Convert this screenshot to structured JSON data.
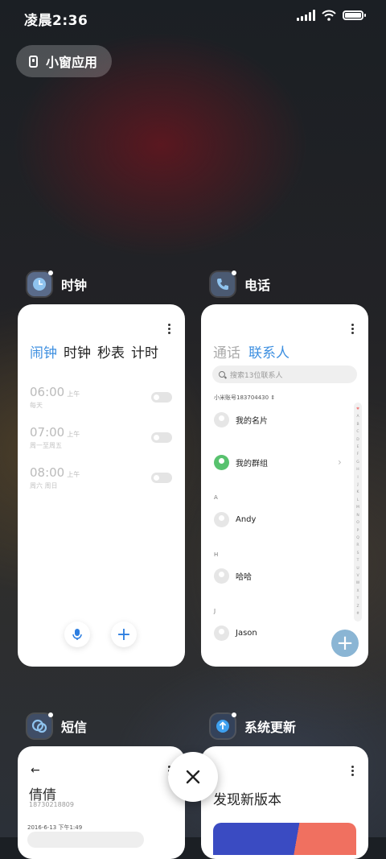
{
  "status_bar": {
    "time": "凌晨2:36"
  },
  "floating_window_button": {
    "label": "小窗应用"
  },
  "apps": {
    "clock": {
      "name": "时钟",
      "tabs": [
        "闹钟",
        "时钟",
        "秒表",
        "计时"
      ],
      "active_tab": 0,
      "alarms": [
        {
          "time": "06:00",
          "ampm": "上午",
          "repeat": "每天"
        },
        {
          "time": "07:00",
          "ampm": "上午",
          "repeat": "周一至周五"
        },
        {
          "time": "08:00",
          "ampm": "上午",
          "repeat": "周六 周日"
        }
      ]
    },
    "phone": {
      "name": "电话",
      "tabs": [
        "通话",
        "联系人"
      ],
      "active_tab": 1,
      "search_placeholder": "搜索13位联系人",
      "account": "小米账号183704430",
      "items": {
        "my_card": "我的名片",
        "my_groups": "我的群组",
        "letter_a": "A",
        "andy": "Andy",
        "letter_h": "H",
        "haha": "哈哈",
        "letter_j": "J",
        "jason": "Jason"
      },
      "alpha_index": [
        "♥",
        "A",
        "B",
        "C",
        "D",
        "E",
        "F",
        "G",
        "H",
        "I",
        "J",
        "K",
        "L",
        "M",
        "N",
        "O",
        "P",
        "Q",
        "R",
        "S",
        "T",
        "U",
        "V",
        "W",
        "X",
        "Y",
        "Z",
        "#"
      ]
    },
    "sms": {
      "name": "短信",
      "contact_name": "倩倩",
      "contact_number": "18730218809",
      "date": "2016-6-13 下午1:49"
    },
    "updater": {
      "name": "系统更新",
      "title": "发现新版本"
    }
  },
  "colors": {
    "accent": "#3d8fe0",
    "clock_icon": "#5a6b8a",
    "phone_icon": "#4b5a72",
    "sms_icon": "#3f4d66",
    "update_icon": "#34425a",
    "groups_avatar": "#58c26e"
  },
  "icons": {
    "close": "close-icon",
    "mic": "microphone-icon",
    "add": "plus-icon"
  }
}
